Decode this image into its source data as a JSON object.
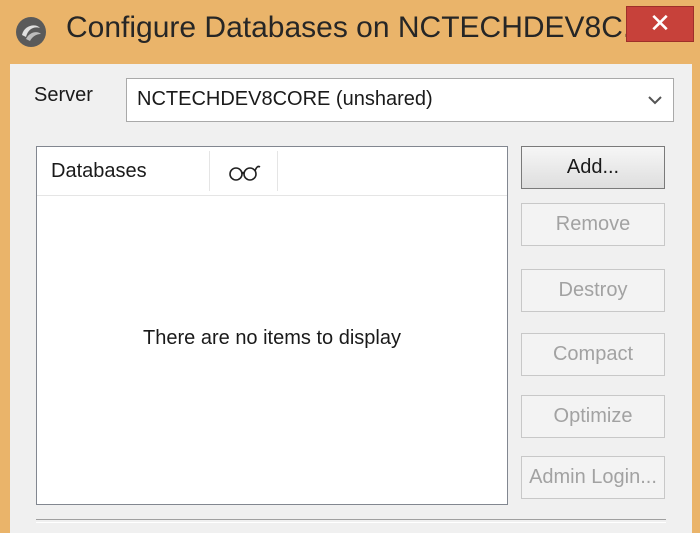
{
  "window": {
    "title": "Configure Databases on NCTECHDEV8C...",
    "close_label": "✕"
  },
  "server": {
    "label": "Server",
    "selected": "NCTECHDEV8CORE (unshared)"
  },
  "list": {
    "column_databases": "Databases",
    "empty_message": "There are no items to display"
  },
  "buttons": {
    "add": "Add...",
    "remove": "Remove",
    "destroy": "Destroy",
    "compact": "Compact",
    "optimize": "Optimize",
    "admin_login": "Admin Login..."
  },
  "colors": {
    "titlebar": "#eab46a",
    "close": "#c7413a",
    "client": "#f0f0f0"
  },
  "icons": {
    "app": "database-app-icon",
    "column": "glasses-icon",
    "dropdown": "chevron-down-icon"
  }
}
